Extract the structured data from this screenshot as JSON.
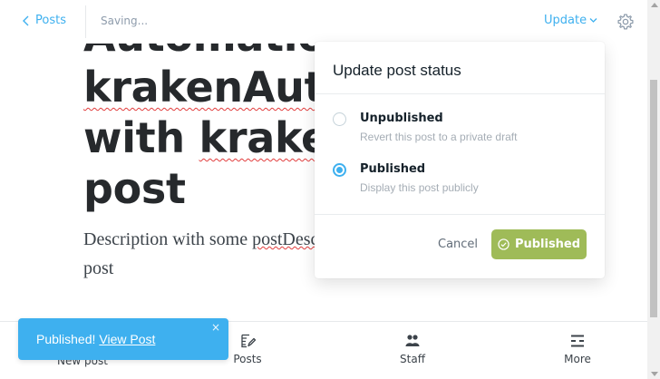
{
  "header": {
    "back_label": "Posts",
    "status": "Saving...",
    "update_label": "Update"
  },
  "editor": {
    "title_lines": [
      "Automation",
      "krakenAuto",
      "with kraken",
      "post"
    ],
    "body_line1_a": "Description with some ",
    "body_line1_b": "postDesc",
    "body_line2": "post"
  },
  "popover": {
    "title": "Update post status",
    "options": [
      {
        "label": "Unpublished",
        "description": "Revert this post to a private draft",
        "selected": false
      },
      {
        "label": "Published",
        "description": "Display this post publicly",
        "selected": true
      }
    ],
    "cancel_label": "Cancel",
    "confirm_label": "Published"
  },
  "bottom_nav": {
    "items": [
      {
        "label": "New post",
        "icon": "new-post-icon"
      },
      {
        "label": "Posts",
        "icon": "posts-icon"
      },
      {
        "label": "Staff",
        "icon": "staff-icon"
      },
      {
        "label": "More",
        "icon": "menu-icon"
      }
    ]
  },
  "toast": {
    "message": "Published!",
    "link": "View Post",
    "close": "×"
  },
  "colors": {
    "accent": "#3eb0ef",
    "confirm": "#9fbb58",
    "toast_bg": "#3eb0ef"
  }
}
